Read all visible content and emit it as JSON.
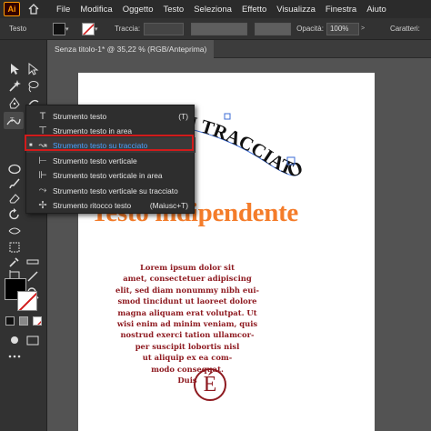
{
  "app": {
    "logo": "Ai",
    "home_icon": "home-icon"
  },
  "menubar": {
    "items": [
      "File",
      "Modifica",
      "Oggetto",
      "Testo",
      "Seleziona",
      "Effetto",
      "Visualizza",
      "Finestra",
      "Aiuto"
    ]
  },
  "controlbar": {
    "tool_name": "Testo",
    "stroke_label": "Traccia:",
    "opacity_label": "Opacità:",
    "opacity_value": "100%",
    "chars_label": "Caratteri:"
  },
  "tab": {
    "title": "Senza titolo-1* @ 35,22 % (RGB/Anteprima)"
  },
  "flyout": {
    "items": [
      {
        "icon": "type-tool-icon",
        "label": "Strumento testo",
        "shortcut": "(T)"
      },
      {
        "icon": "area-type-tool-icon",
        "label": "Strumento testo in area",
        "shortcut": ""
      },
      {
        "icon": "type-on-path-tool-icon",
        "label": "Strumento testo su tracciato",
        "shortcut": ""
      },
      {
        "icon": "vertical-type-tool-icon",
        "label": "Strumento testo verticale",
        "shortcut": ""
      },
      {
        "icon": "vertical-area-type-tool-icon",
        "label": "Strumento testo verticale in area",
        "shortcut": ""
      },
      {
        "icon": "vertical-type-on-path-tool-icon",
        "label": "Strumento testo verticale su tracciato",
        "shortcut": ""
      },
      {
        "icon": "touch-type-tool-icon",
        "label": "Strumento ritocco testo",
        "shortcut": "(Maiusc+T)"
      }
    ]
  },
  "canvas": {
    "path_text": "U TRACCIATO",
    "heading": "Testo indipendente",
    "lorem_lines": [
      "Lorem ipsum dolor sit",
      "amet, consectetuer adipiscing",
      "elit, sed diam nonummy nibh eui-",
      "smod tincidunt ut laoreet dolore",
      "magna aliquam erat volutpat. Ut",
      "wisi enim ad minim veniam, quis",
      "nostrud exerci tation ullamcor-",
      "per suscipit lobortis nisl",
      "ut aliquip ex ea com-",
      "modo consequat.",
      "Duis"
    ],
    "logo_letter": "É"
  },
  "colors": {
    "heading": "#f47c2a",
    "body_text": "#8e1a20",
    "highlight": "#d11b1b",
    "selection_text": "#4aa2ff"
  }
}
